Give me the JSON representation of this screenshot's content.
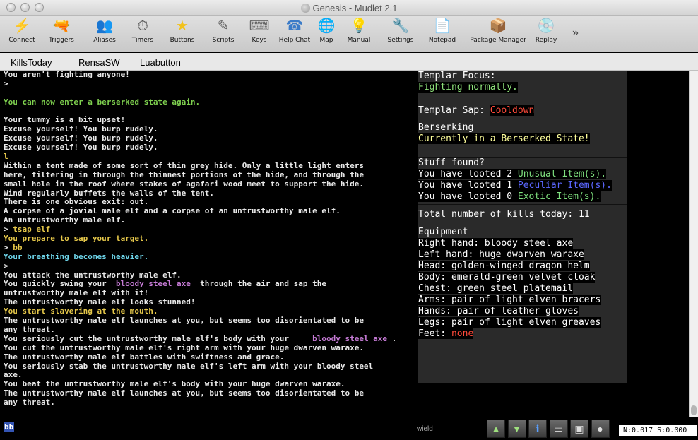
{
  "window": {
    "title": "Genesis - Mudlet 2.1"
  },
  "toolbar": {
    "items": [
      {
        "label": "Connect",
        "glyph": "⚡",
        "color": "#e3a21a"
      },
      {
        "label": "Triggers",
        "glyph": "🔫",
        "color": "#b55"
      },
      {
        "label": "Aliases",
        "glyph": "👥",
        "color": "#a77"
      },
      {
        "label": "Timers",
        "glyph": "⏱",
        "color": "#555"
      },
      {
        "label": "Buttons",
        "glyph": "★",
        "color": "#f2c21a"
      },
      {
        "label": "Scripts",
        "glyph": "✎",
        "color": "#666"
      },
      {
        "label": "Keys",
        "glyph": "⌨",
        "color": "#666"
      },
      {
        "label": "Help Chat",
        "glyph": "☎",
        "color": "#3a7bc8"
      },
      {
        "label": "Map",
        "glyph": "🌐",
        "color": "#2a5fb5"
      },
      {
        "label": "Manual",
        "glyph": "💡",
        "color": "#f0c020"
      },
      {
        "label": "Settings",
        "glyph": "🔧",
        "color": "#777"
      },
      {
        "label": "Notepad",
        "glyph": "📄",
        "color": "#888"
      },
      {
        "label": "Package Manager",
        "glyph": "📦",
        "color": "#b07a3a"
      },
      {
        "label": "Replay",
        "glyph": "💿",
        "color": "#aaa"
      }
    ],
    "more": "»"
  },
  "buttons": [
    "KillsToday",
    "RensaSW",
    "Luabutton"
  ],
  "output": [
    [
      {
        "t": "You aren't fighting anyone!",
        "c": ""
      }
    ],
    [
      {
        "t": ">",
        "c": ""
      }
    ],
    [
      {
        "t": "",
        "c": ""
      }
    ],
    [
      {
        "t": "You can now enter a berserked state again.",
        "c": "c-green"
      }
    ],
    [
      {
        "t": "",
        "c": ""
      }
    ],
    [
      {
        "t": "Your tummy is a bit upset!",
        "c": ""
      }
    ],
    [
      {
        "t": "Excuse yourself! You burp rudely.",
        "c": ""
      }
    ],
    [
      {
        "t": "Excuse yourself! You burp rudely.",
        "c": ""
      }
    ],
    [
      {
        "t": "Excuse yourself! You burp rudely.",
        "c": ""
      }
    ],
    [
      {
        "t": "l",
        "c": "c-echo"
      }
    ],
    [
      {
        "t": "Within a tent made of some sort of thin grey hide. Only a little light enters",
        "c": ""
      }
    ],
    [
      {
        "t": "here, filtering in through the thinnest portions of the hide, and through the",
        "c": ""
      }
    ],
    [
      {
        "t": "small hole in the roof where stakes of agafari wood meet to support the hide.",
        "c": ""
      }
    ],
    [
      {
        "t": "Wind regularly buffets the walls of the tent.",
        "c": ""
      }
    ],
    [
      {
        "t": "There is one obvious exit: out.",
        "c": ""
      }
    ],
    [
      {
        "t": "A corpse of a jovial male elf and a corpse of an untrustworthy male elf.",
        "c": ""
      }
    ],
    [
      {
        "t": "An untrustworthy male elf.",
        "c": ""
      }
    ],
    [
      {
        "t": "> ",
        "c": ""
      },
      {
        "t": "tsap elf",
        "c": "c-echo"
      }
    ],
    [
      {
        "t": "You prepare to sap your target.",
        "c": "c-yellow"
      }
    ],
    [
      {
        "t": "> ",
        "c": ""
      },
      {
        "t": "bb",
        "c": "c-echo"
      }
    ],
    [
      {
        "t": "Your breathing becomes heavier.",
        "c": "c-cyan"
      }
    ],
    [
      {
        "t": ">",
        "c": ""
      }
    ],
    [
      {
        "t": "You attack the untrustworthy male elf.",
        "c": ""
      }
    ],
    [
      {
        "t": "You quickly swing your  ",
        "c": ""
      },
      {
        "t": "bloody steel axe",
        "c": "c-purple"
      },
      {
        "t": "  through the air and sap the",
        "c": ""
      }
    ],
    [
      {
        "t": "untrustworthy male elf with it!",
        "c": ""
      }
    ],
    [
      {
        "t": "The untrustworthy male elf looks stunned!",
        "c": ""
      }
    ],
    [
      {
        "t": "You start slavering at the mouth.",
        "c": "c-yellow"
      }
    ],
    [
      {
        "t": "The untrustworthy male elf launches at you, but seems too disorientated to be",
        "c": ""
      }
    ],
    [
      {
        "t": "any threat.",
        "c": ""
      }
    ],
    [
      {
        "t": "You seriously cut the untrustworthy male elf's body with your     ",
        "c": ""
      },
      {
        "t": "bloody steel axe",
        "c": "c-purple"
      },
      {
        "t": " .",
        "c": ""
      }
    ],
    [
      {
        "t": "You cut the untrustworthy male elf's right arm with your huge dwarven waraxe.",
        "c": ""
      }
    ],
    [
      {
        "t": "The untrustworthy male elf battles with swiftness and grace.",
        "c": ""
      }
    ],
    [
      {
        "t": "You seriously stab the untrustworthy male elf's left arm with your bloody steel",
        "c": ""
      }
    ],
    [
      {
        "t": "axe.",
        "c": ""
      }
    ],
    [
      {
        "t": "You beat the untrustworthy male elf's body with your huge dwarven waraxe.",
        "c": ""
      }
    ],
    [
      {
        "t": "The untrustworthy male elf launches at you, but seems too disorientated to be",
        "c": ""
      }
    ],
    [
      {
        "t": "any threat.",
        "c": ""
      }
    ]
  ],
  "panel": {
    "focus_label": "Templar Focus:",
    "focus_value": "Fighting normally.",
    "sap_label": "Templar Sap: ",
    "sap_value": "Cooldown",
    "berserk_label": "Berserking",
    "berserk_value": "Currently in a Berserked State!",
    "stuff_label": "Stuff found?",
    "loot_prefix": "You have looted ",
    "loot": [
      {
        "count": "2",
        "name": "Unusual Item(s)."
      },
      {
        "count": "1",
        "name": "Peculiar Item(s)."
      },
      {
        "count": "0",
        "name": "Exotic Item(s)."
      }
    ],
    "kills": "Total number of kills today: 11",
    "equip_label": "Equipment",
    "equipment": [
      "Right hand: bloody steel axe",
      "Left hand: huge dwarven waraxe",
      "Head: golden-winged dragon helm",
      "Body: emerald-green velvet cloak",
      "Chest: green steel platemail",
      "Arms: pair of light elven bracers",
      "Hands: pair of leather gloves",
      "Legs: pair of light elven greaves"
    ],
    "feet_label": "Feet: ",
    "feet_value": "none"
  },
  "bottom": {
    "command": "bb",
    "wield": "wield",
    "icons": [
      "up-arrow-icon",
      "down-arrow-icon",
      "info-icon",
      "ellipsis-icon",
      "window-icon",
      "record-icon"
    ],
    "coords": "N:0.017 S:0.000"
  }
}
